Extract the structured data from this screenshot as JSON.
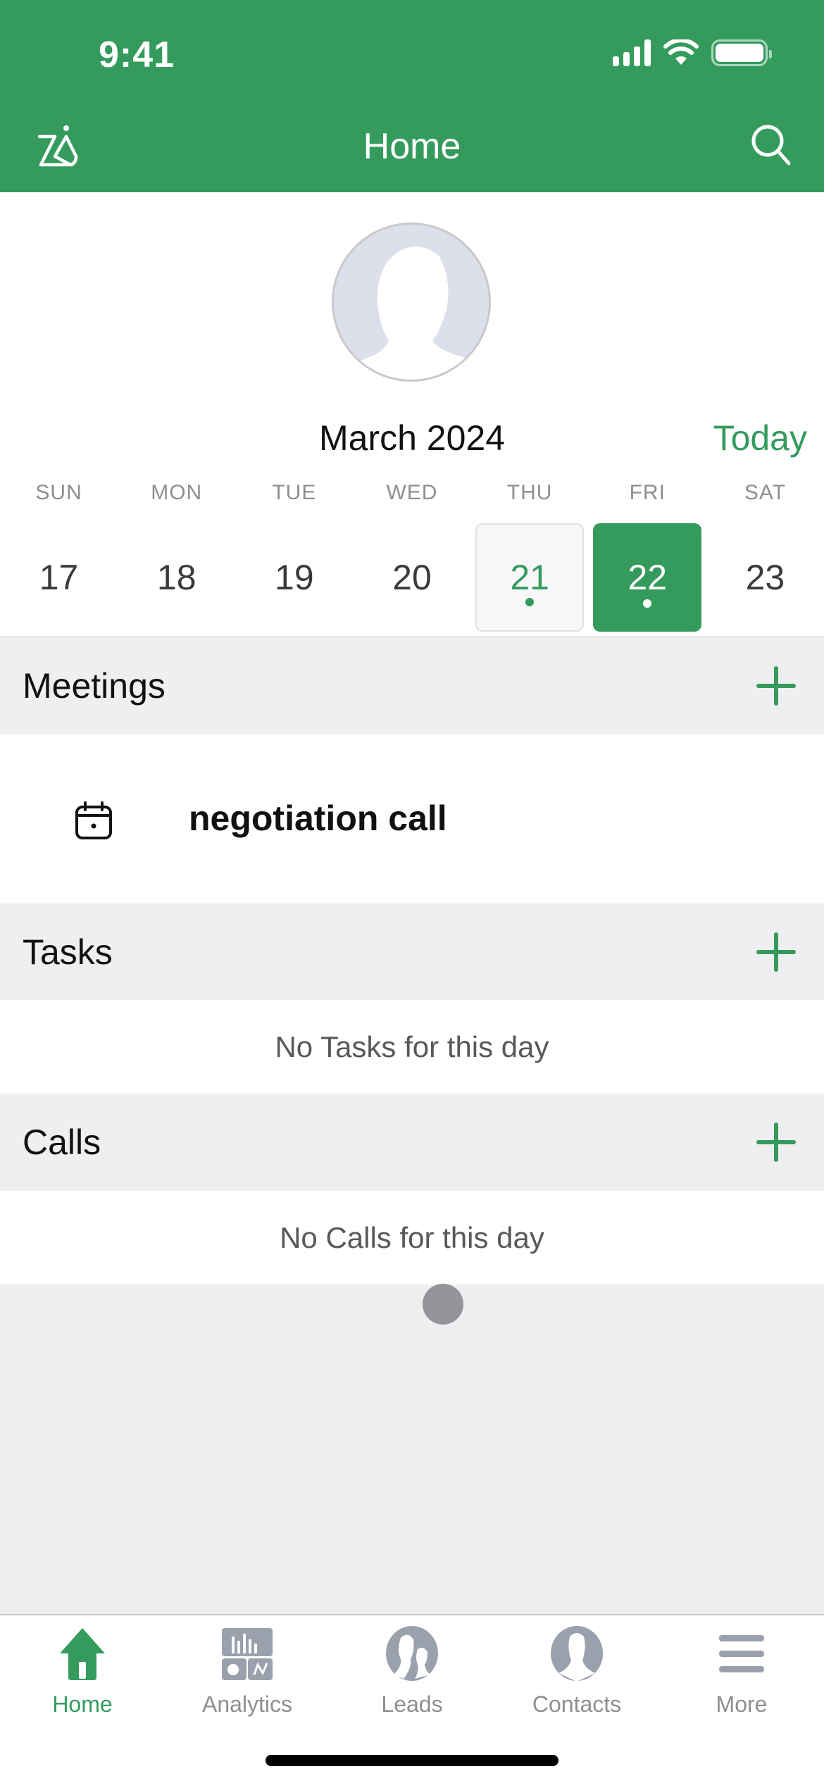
{
  "status_bar": {
    "time": "9:41"
  },
  "nav": {
    "title": "Home",
    "left_icon": "zia-icon",
    "right_icon": "search-icon"
  },
  "profile": {
    "avatar": "avatar-placeholder"
  },
  "calendar": {
    "month_label": "March 2024",
    "today_label": "Today",
    "weekdays": [
      "SUN",
      "MON",
      "TUE",
      "WED",
      "THU",
      "FRI",
      "SAT"
    ],
    "dates": [
      {
        "day": "17",
        "state": "normal",
        "has_event": false
      },
      {
        "day": "18",
        "state": "normal",
        "has_event": false
      },
      {
        "day": "19",
        "state": "normal",
        "has_event": false
      },
      {
        "day": "20",
        "state": "normal",
        "has_event": false
      },
      {
        "day": "21",
        "state": "today",
        "has_event": true
      },
      {
        "day": "22",
        "state": "selected",
        "has_event": true
      },
      {
        "day": "23",
        "state": "normal",
        "has_event": false
      }
    ]
  },
  "sections": {
    "meetings": {
      "title": "Meetings",
      "items": [
        {
          "title": "negotiation call",
          "icon": "calendar-icon"
        }
      ]
    },
    "tasks": {
      "title": "Tasks",
      "empty_text": "No Tasks for this day"
    },
    "calls": {
      "title": "Calls",
      "empty_text": "No Calls for this day"
    }
  },
  "tabbar": {
    "items": [
      {
        "label": "Home",
        "icon": "home-icon",
        "active": true
      },
      {
        "label": "Analytics",
        "icon": "analytics-icon",
        "active": false
      },
      {
        "label": "Leads",
        "icon": "leads-icon",
        "active": false
      },
      {
        "label": "Contacts",
        "icon": "contacts-icon",
        "active": false
      },
      {
        "label": "More",
        "icon": "menu-icon",
        "active": false
      }
    ]
  },
  "colors": {
    "brand": "#349b5d",
    "section_bg": "#efeef1",
    "inactive": "#8e8e93"
  }
}
